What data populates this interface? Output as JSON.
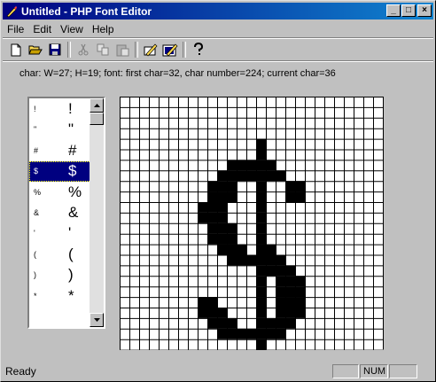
{
  "window": {
    "title": "Untitled - PHP Font Editor",
    "controls": {
      "minimize": "_",
      "maximize": "□",
      "close": "×"
    }
  },
  "menu": {
    "file": "File",
    "edit": "Edit",
    "view": "View",
    "help": "Help"
  },
  "toolbar": {
    "buttons": [
      "new-icon",
      "open-icon",
      "save-icon",
      "cut-icon",
      "copy-icon",
      "paste-icon",
      "edit-char-icon",
      "edit-font-icon",
      "help-icon"
    ]
  },
  "info": "char: W=27; H=19;  font: first char=32, char number=224; current char=36",
  "charlist": {
    "rows": [
      {
        "small": "!",
        "big": "!"
      },
      {
        "small": "\"",
        "big": "\""
      },
      {
        "small": "#",
        "big": "#"
      },
      {
        "small": "$",
        "big": "$"
      },
      {
        "small": "%",
        "big": "%"
      },
      {
        "small": "&",
        "big": "&"
      },
      {
        "small": "'",
        "big": "'"
      },
      {
        "small": "(",
        "big": "("
      },
      {
        "small": ")",
        "big": ")"
      },
      {
        "small": "*",
        "big": "*"
      }
    ],
    "selected_index": 3
  },
  "glyph": {
    "char": "$",
    "cols": 27,
    "rows": 24,
    "pixels": [
      [
        14,
        4,
        1
      ],
      [
        14,
        5,
        1
      ],
      [
        11,
        6,
        5
      ],
      [
        10,
        7,
        7
      ],
      [
        9,
        8,
        3
      ],
      [
        14,
        8,
        1
      ],
      [
        17,
        8,
        2
      ],
      [
        9,
        9,
        3
      ],
      [
        14,
        9,
        1
      ],
      [
        17,
        9,
        2
      ],
      [
        8,
        10,
        3
      ],
      [
        14,
        10,
        1
      ],
      [
        8,
        11,
        3
      ],
      [
        14,
        11,
        1
      ],
      [
        9,
        12,
        3
      ],
      [
        14,
        12,
        1
      ],
      [
        9,
        13,
        3
      ],
      [
        14,
        13,
        1
      ],
      [
        10,
        14,
        3
      ],
      [
        14,
        14,
        2
      ],
      [
        11,
        15,
        6
      ],
      [
        14,
        16,
        4
      ],
      [
        14,
        17,
        1
      ],
      [
        16,
        17,
        3
      ],
      [
        14,
        18,
        1
      ],
      [
        16,
        18,
        3
      ],
      [
        8,
        19,
        2
      ],
      [
        14,
        19,
        1
      ],
      [
        16,
        19,
        3
      ],
      [
        8,
        20,
        3
      ],
      [
        14,
        20,
        1
      ],
      [
        16,
        20,
        3
      ],
      [
        9,
        21,
        3
      ],
      [
        14,
        21,
        1
      ],
      [
        15,
        21,
        3
      ],
      [
        10,
        22,
        7
      ],
      [
        14,
        23,
        1
      ],
      [
        14,
        24,
        1
      ]
    ]
  },
  "status": {
    "text": "Ready",
    "num": "NUM"
  }
}
